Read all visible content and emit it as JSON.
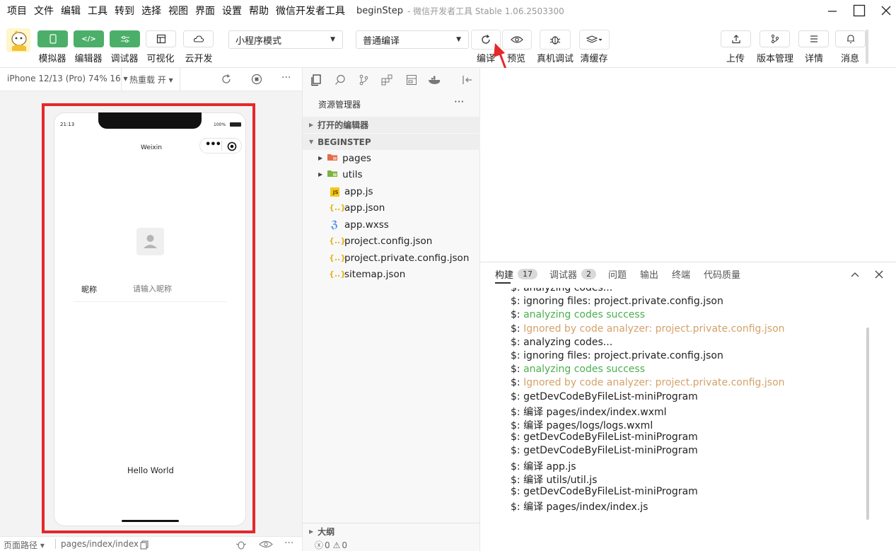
{
  "menubar": {
    "items": [
      "项目",
      "文件",
      "编辑",
      "工具",
      "转到",
      "选择",
      "视图",
      "界面",
      "设置",
      "帮助",
      "微信开发者工具"
    ],
    "title": "beginStep",
    "subtitle": "- 微信开发者工具 Stable 1.06.2503300"
  },
  "toolbar": {
    "simulator": "模拟器",
    "editor": "编辑器",
    "debugger": "调试器",
    "visual": "可视化",
    "cloud": "云开发",
    "mode_select": "小程序模式",
    "compile_select": "普通编译",
    "compile": "编译",
    "preview": "预览",
    "real_debug": "真机调试",
    "clear_cache": "清缓存",
    "upload": "上传",
    "version": "版本管理",
    "details": "详情",
    "messages": "消息"
  },
  "simulator": {
    "device": "iPhone 12/13 (Pro) 74% 16 ▾",
    "hot_reload": "热重载 开 ▾",
    "time": "21:13",
    "battery": "100%",
    "nav_title": "Weixin",
    "nickname_label": "昵称",
    "nickname_placeholder": "请输入昵称",
    "hello": "Hello World"
  },
  "status": {
    "page_path_label": "页面路径 ▾",
    "page_path": "pages/index/index",
    "errors": "0",
    "warnings": "0"
  },
  "explorer": {
    "title": "资源管理器",
    "open_editors": "打开的编辑器",
    "project": "BEGINSTEP",
    "outline": "大纲",
    "files": [
      {
        "name": "pages",
        "type": "folder-red"
      },
      {
        "name": "utils",
        "type": "folder-green"
      },
      {
        "name": "app.js",
        "type": "js"
      },
      {
        "name": "app.json",
        "type": "json"
      },
      {
        "name": "app.wxss",
        "type": "css"
      },
      {
        "name": "project.config.json",
        "type": "json"
      },
      {
        "name": "project.private.config.json",
        "type": "json"
      },
      {
        "name": "sitemap.json",
        "type": "json"
      }
    ]
  },
  "console": {
    "tabs": [
      {
        "label": "构建",
        "badge": "17"
      },
      {
        "label": "调试器",
        "badge": "2"
      },
      {
        "label": "问题",
        "badge": ""
      },
      {
        "label": "输出",
        "badge": ""
      },
      {
        "label": "终端",
        "badge": ""
      },
      {
        "label": "代码质量",
        "badge": ""
      }
    ],
    "lines": [
      {
        "prefix": "$: ",
        "text": "analyzing codes...",
        "color": "default"
      },
      {
        "prefix": "$: ",
        "text": "ignoring files: project.private.config.json",
        "color": "default"
      },
      {
        "prefix": "$: ",
        "text": "analyzing codes success",
        "color": "green"
      },
      {
        "prefix": "$: ",
        "text": "Ignored by code analyzer: project.private.config.json",
        "color": "yellow"
      },
      {
        "prefix": "$: ",
        "text": "analyzing codes...",
        "color": "default"
      },
      {
        "prefix": "$: ",
        "text": "ignoring files: project.private.config.json",
        "color": "default"
      },
      {
        "prefix": "$: ",
        "text": "analyzing codes success",
        "color": "green"
      },
      {
        "prefix": "$: ",
        "text": "Ignored by code analyzer: project.private.config.json",
        "color": "yellow"
      },
      {
        "prefix": "$: ",
        "text": "getDevCodeByFileList-miniProgram",
        "color": "default"
      },
      {
        "prefix": "$: ",
        "text": "编译 pages/index/index.wxml",
        "color": "default"
      },
      {
        "prefix": "$: ",
        "text": "编译 pages/logs/logs.wxml",
        "color": "default"
      },
      {
        "prefix": "$: ",
        "text": "getDevCodeByFileList-miniProgram",
        "color": "default"
      },
      {
        "prefix": "$: ",
        "text": "getDevCodeByFileList-miniProgram",
        "color": "default"
      },
      {
        "prefix": "$: ",
        "text": "编译 app.js",
        "color": "default"
      },
      {
        "prefix": "$: ",
        "text": "编译 utils/util.js",
        "color": "default"
      },
      {
        "prefix": "$: ",
        "text": "getDevCodeByFileList-miniProgram",
        "color": "default"
      },
      {
        "prefix": "$: ",
        "text": "编译 pages/index/index.js",
        "color": "default"
      }
    ]
  },
  "colors": {
    "accent_green": "#4caf69",
    "highlight_red": "#e5282b",
    "log_green": "#4caf50",
    "log_yellow": "#d4a26a"
  }
}
